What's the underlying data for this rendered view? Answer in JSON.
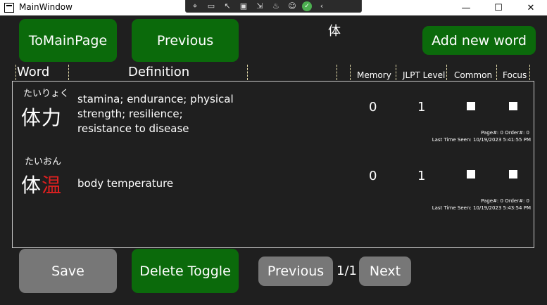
{
  "window": {
    "title": "MainWindow",
    "controls": [
      "—",
      "☐",
      "✕"
    ]
  },
  "debug_toolbar": {
    "icons": [
      "select-element-icon",
      "record-icon",
      "pointer-icon",
      "layout-adorner-icon",
      "track-focus-icon",
      "hot-reload-icon",
      "accessibility-icon",
      "check-icon",
      "collapse-icon"
    ]
  },
  "top": {
    "to_main": "ToMainPage",
    "previous": "Previous",
    "kanji_title": "体",
    "add_new": "Add new word"
  },
  "columns": {
    "word": "Word",
    "definition": "Definition",
    "memory": "Memory",
    "jlpt": "JLPT Level",
    "common": "Common",
    "focus": "Focus"
  },
  "rows": [
    {
      "reading": "たいりょく",
      "kanji": "体力",
      "definition": "stamina; endurance; physical strength; resilience; resistance to disease",
      "memory": "0",
      "jlpt": "1",
      "common": false,
      "focus": false,
      "page_line": "Page#:   0     Order#:   0",
      "last_seen": "Last Time Seen:   10/19/2023 5:41:55 PM"
    },
    {
      "reading": "たいおん",
      "kanji_a": "体",
      "kanji_b": "温",
      "definition": "body temperature",
      "memory": "0",
      "jlpt": "1",
      "common": false,
      "focus": false,
      "page_line": "Page#:   0     Order#:   0",
      "last_seen": "Last Time Seen:   10/19/2023 5:43:54 PM"
    }
  ],
  "bottom": {
    "save": "Save",
    "delete_toggle": "Delete Toggle",
    "previous": "Previous",
    "page": "1/1",
    "next": "Next"
  }
}
